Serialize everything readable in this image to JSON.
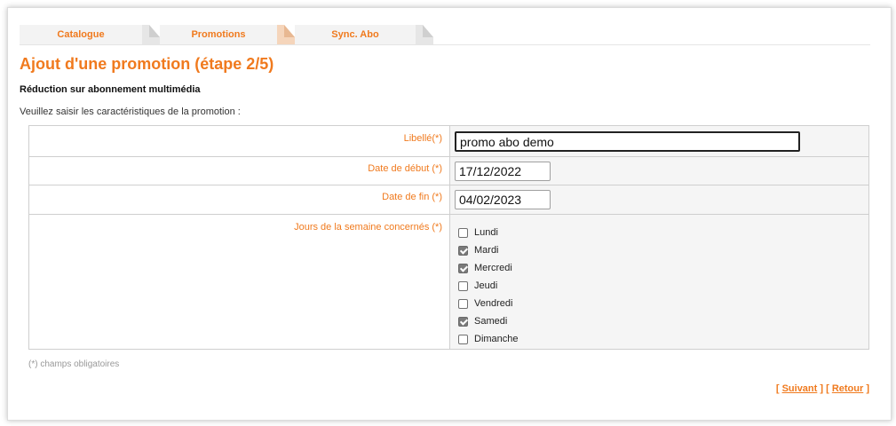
{
  "tabs": [
    {
      "label": "Catalogue"
    },
    {
      "label": "Promotions"
    },
    {
      "label": "Sync. Abo"
    }
  ],
  "page": {
    "title": "Ajout d'une promotion (étape 2/5)",
    "subtitle": "Réduction sur abonnement multimédia",
    "intro": "Veuillez saisir les caractéristiques de la promotion :"
  },
  "form": {
    "libelle": {
      "label": "Libellé(*)",
      "value": "promo abo demo"
    },
    "date_debut": {
      "label": "Date de début (*)",
      "value": "17/12/2022"
    },
    "date_fin": {
      "label": "Date de fin (*)",
      "value": "04/02/2023"
    },
    "jours": {
      "label": "Jours de la semaine concernés (*)",
      "options": [
        {
          "label": "Lundi",
          "checked": false
        },
        {
          "label": "Mardi",
          "checked": true
        },
        {
          "label": "Mercredi",
          "checked": true
        },
        {
          "label": "Jeudi",
          "checked": false
        },
        {
          "label": "Vendredi",
          "checked": false
        },
        {
          "label": "Samedi",
          "checked": true
        },
        {
          "label": "Dimanche",
          "checked": false
        }
      ]
    }
  },
  "footer": {
    "required_note": "(*) champs obligatoires",
    "next_label": "Suivant",
    "back_label": "Retour"
  },
  "colors": {
    "accent": "#f07a1e",
    "cell_bg": "#f5f5f5",
    "border": "#cfcfcf"
  }
}
